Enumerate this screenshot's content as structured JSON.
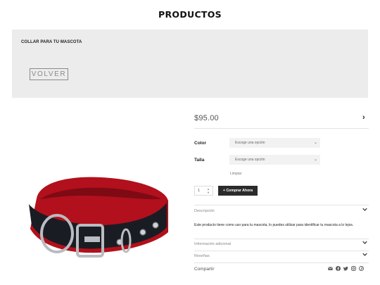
{
  "page": {
    "title": "PRODUCTOS"
  },
  "banner": {
    "breadcrumb": "COLLAR PARA TU MASCOTA",
    "back_label": "VOLVER"
  },
  "product": {
    "price": "$95.00",
    "options": [
      {
        "label": "Color",
        "placeholder": "Escoge una opción"
      },
      {
        "label": "Talla",
        "placeholder": "Escoge una opción"
      }
    ],
    "clear_label": "Limpiar",
    "quantity": "1",
    "buy_label": "Comprar Ahora"
  },
  "accordion": {
    "description_label": "Descripción",
    "description_text": "Este producto tiene como uso para tu mascota, lo puedes utilizar para identificar tu mascota a lo lejos.",
    "info_label": "Información adicional",
    "reviews_label": "Reseñas"
  },
  "share": {
    "label": "Compartir",
    "icons": [
      "email-icon",
      "facebook-icon",
      "twitter-icon",
      "instagram-icon",
      "pinterest-icon"
    ]
  },
  "colors": {
    "collar_red": "#b2101c",
    "collar_black": "#1a1c24",
    "metal": "#b9bcc0",
    "banner_bg": "#ececec",
    "button_bg": "#2b2b2b"
  }
}
